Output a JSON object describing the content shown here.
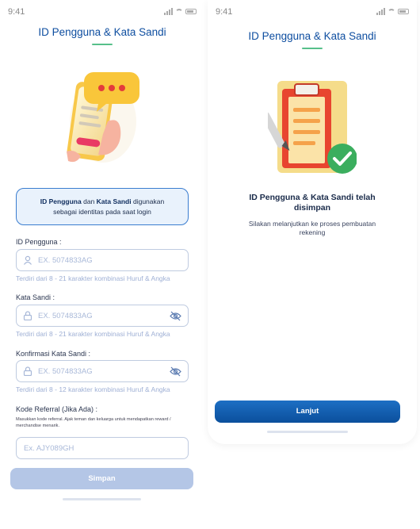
{
  "left": {
    "status_time": "9:41",
    "title": "ID Pengguna & Kata Sandi",
    "info": {
      "bold1": "ID Pengguna",
      "and": "dan",
      "bold2": "Kata Sandi",
      "rest1": "digunakan",
      "rest2": "sebagai identitas pada saat login"
    },
    "user_id": {
      "label": "ID Pengguna :",
      "placeholder": "EX. 5074833AG",
      "hint": "Terdiri dari 8 - 21 karakter kombinasi Huruf & Angka"
    },
    "password": {
      "label": "Kata Sandi :",
      "placeholder": "EX. 5074833AG",
      "hint": "Terdiri dari 8 - 21 karakter kombinasi Huruf & Angka"
    },
    "confirm": {
      "label": "Konfirmasi Kata Sandi :",
      "placeholder": "EX. 5074833AG",
      "hint": "Terdiri dari 8 - 12 karakter kombinasi Huruf & Angka"
    },
    "referral": {
      "label": "Kode Referral (Jika Ada) :",
      "note": "Masukkan kode referral. Ajak teman dan keluarga untuk mendapatkan reward / merchandise menarik.",
      "placeholder": "Ex. AJY089GH"
    },
    "save_label": "Simpan"
  },
  "right": {
    "status_time": "9:41",
    "title": "ID Pengguna & Kata Sandi",
    "success_title_1": "ID Pengguna & Kata Sandi telah",
    "success_title_2": "disimpan",
    "success_sub_1": "Silakan melanjutkan ke proses pembuatan",
    "success_sub_2": "rekening",
    "continue_label": "Lanjut"
  },
  "colors": {
    "brand": "#0e4ea0",
    "accent_green": "#57c08a",
    "disabled_button": "#b4c6e6",
    "hint": "#9fb0d5"
  }
}
